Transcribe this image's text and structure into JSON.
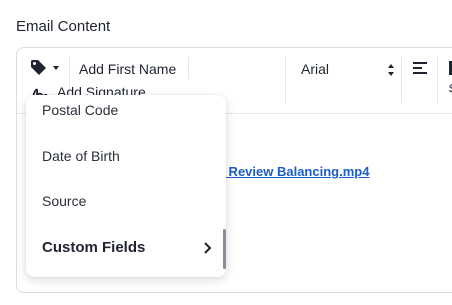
{
  "section": {
    "title": "Email Content"
  },
  "toolbar": {
    "tag_icon": "tag-icon",
    "add_first_name": "Add First Name",
    "font": {
      "selected": "Arial"
    },
    "align_icon": "align-left-icon",
    "add_signature": "Add Signature"
  },
  "body": {
    "video_link": "n Review Balancing.mp4"
  },
  "dropdown": {
    "items": [
      {
        "label": "Postal Code"
      },
      {
        "label": "Date of Birth"
      },
      {
        "label": "Source"
      },
      {
        "label": "Custom Fields"
      }
    ]
  },
  "colors": {
    "link": "#1a5ec7",
    "border": "#d9dde3",
    "text": "#1f2430"
  }
}
